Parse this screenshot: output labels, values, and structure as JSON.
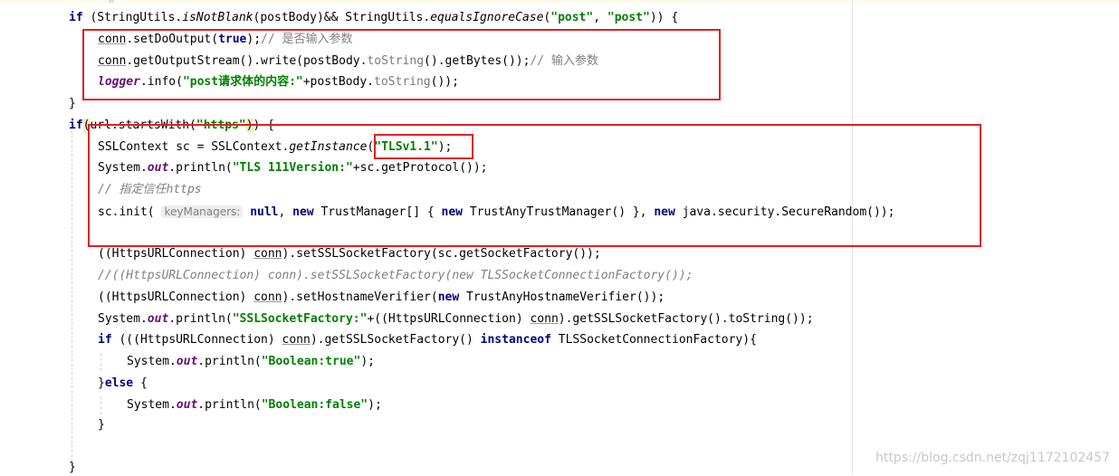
{
  "code_lines": [
    {
      "id": "l1",
      "segments": [
        [
          "kw",
          "if"
        ],
        [
          "p",
          " (StringUtils."
        ],
        [
          "it",
          "isNotBlank"
        ],
        [
          "p",
          "(postBody)&& StringUtils."
        ],
        [
          "it",
          "equalsIgnoreCase"
        ],
        [
          "p",
          "("
        ],
        [
          "str",
          "\"post\""
        ],
        [
          "p",
          ", "
        ],
        [
          "str",
          "\"post\""
        ],
        [
          "p",
          ")) {"
        ]
      ]
    },
    {
      "id": "l2",
      "segments": [
        [
          "ul",
          "conn"
        ],
        [
          "p",
          ".setDoOutput("
        ],
        [
          "kw",
          "true"
        ],
        [
          "p",
          ");"
        ],
        [
          "cmt-n",
          "// 是否输入参数"
        ]
      ]
    },
    {
      "id": "l3",
      "segments": [
        [
          "ul",
          "conn"
        ],
        [
          "p",
          ".getOutputStream().write(postBody."
        ],
        [
          "mth",
          "toString"
        ],
        [
          "p",
          "().getBytes());"
        ],
        [
          "cmt-n",
          "// 输入参数"
        ]
      ]
    },
    {
      "id": "l4",
      "segments": [
        [
          "fld",
          "logger"
        ],
        [
          "p",
          ".info("
        ],
        [
          "str",
          "\"post请求体的内容:\""
        ],
        [
          "p",
          "+postBody."
        ],
        [
          "mth",
          "toString"
        ],
        [
          "p",
          "());"
        ]
      ]
    },
    {
      "id": "l5",
      "segments": [
        [
          "p",
          "}"
        ]
      ]
    },
    {
      "id": "l6",
      "segments": [
        [
          "kw",
          "if"
        ],
        [
          "hl",
          "("
        ],
        [
          "p",
          "url.startsWith("
        ],
        [
          "str",
          "\"https\""
        ],
        [
          "hl",
          ")"
        ],
        [
          "p",
          ") {"
        ]
      ]
    },
    {
      "id": "l7",
      "segments": [
        [
          "p",
          "SSLContext sc = SSLContext."
        ],
        [
          "it",
          "getInstance"
        ],
        [
          "p",
          "("
        ],
        [
          "str",
          "\"TLSv1.1\""
        ],
        [
          "p",
          ");"
        ]
      ]
    },
    {
      "id": "l8",
      "segments": [
        [
          "p",
          "System."
        ],
        [
          "fld",
          "out"
        ],
        [
          "p",
          ".println("
        ],
        [
          "str",
          "\"TLS 111Version:\""
        ],
        [
          "p",
          "+sc.getProtocol());"
        ]
      ]
    },
    {
      "id": "l9",
      "segments": [
        [
          "cmt",
          "// 指定信任https"
        ]
      ]
    },
    {
      "id": "l10",
      "segments": [
        [
          "p",
          "sc.init( "
        ],
        [
          "hint",
          "keyManagers:"
        ],
        [
          "p",
          " "
        ],
        [
          "kw",
          "null"
        ],
        [
          "p",
          ", "
        ],
        [
          "kw",
          "new"
        ],
        [
          "p",
          " TrustManager[] { "
        ],
        [
          "kw",
          "new"
        ],
        [
          "p",
          " TrustAnyTrustManager() }, "
        ],
        [
          "kw",
          "new"
        ],
        [
          "p",
          " java.security.SecureRandom());"
        ]
      ]
    },
    {
      "id": "l11",
      "segments": [
        [
          "p",
          "((HttpsURLConnection) "
        ],
        [
          "ul",
          "conn"
        ],
        [
          "p",
          ").setSSLSocketFactory(sc.getSocketFactory());"
        ]
      ]
    },
    {
      "id": "l12",
      "segments": [
        [
          "cmt",
          "//((HttpsURLConnection) conn).setSSLSocketFactory(new TLSSocketConnectionFactory());"
        ]
      ]
    },
    {
      "id": "l13",
      "segments": [
        [
          "p",
          "((HttpsURLConnection) "
        ],
        [
          "ul",
          "conn"
        ],
        [
          "p",
          ").setHostnameVerifier("
        ],
        [
          "kw",
          "new"
        ],
        [
          "p",
          " TrustAnyHostnameVerifier());"
        ]
      ]
    },
    {
      "id": "l14",
      "segments": [
        [
          "p",
          "System."
        ],
        [
          "fld",
          "out"
        ],
        [
          "p",
          ".println("
        ],
        [
          "str",
          "\"SSLSocketFactory:\""
        ],
        [
          "p",
          "+((HttpsURLConnection) "
        ],
        [
          "ul",
          "conn"
        ],
        [
          "p",
          ").getSSLSocketFactory().toString());"
        ]
      ]
    },
    {
      "id": "l15",
      "segments": [
        [
          "kw",
          "if"
        ],
        [
          "p",
          " (((HttpsURLConnection) "
        ],
        [
          "ul",
          "conn"
        ],
        [
          "p",
          ").getSSLSocketFactory() "
        ],
        [
          "kw",
          "instanceof"
        ],
        [
          "p",
          " TLSSocketConnectionFactory){"
        ]
      ]
    },
    {
      "id": "l16",
      "segments": [
        [
          "p",
          "System."
        ],
        [
          "fld",
          "out"
        ],
        [
          "p",
          ".println("
        ],
        [
          "str",
          "\"Boolean:true\""
        ],
        [
          "p",
          ");"
        ]
      ]
    },
    {
      "id": "l17",
      "segments": [
        [
          "p",
          "}"
        ],
        [
          "kw",
          "else"
        ],
        [
          "p",
          " {"
        ]
      ]
    },
    {
      "id": "l18",
      "segments": [
        [
          "p",
          "System."
        ],
        [
          "fld",
          "out"
        ],
        [
          "p",
          ".println("
        ],
        [
          "str",
          "\"Boolean:false\""
        ],
        [
          "p",
          ");"
        ]
      ]
    },
    {
      "id": "l19",
      "segments": [
        [
          "p",
          "}"
        ]
      ]
    },
    {
      "id": "l20",
      "segments": [
        [
          "p",
          "}"
        ]
      ]
    }
  ],
  "watermark": "https://blog.csdn.net/zqj1172102457"
}
